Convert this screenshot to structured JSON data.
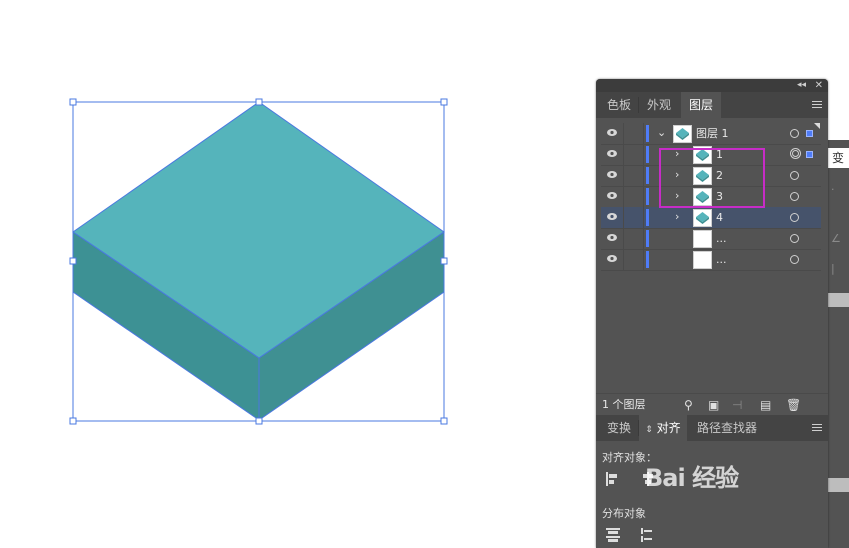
{
  "canvas": {
    "box": {
      "top_color": "#55b4bb",
      "left_color": "#3d9194",
      "right_color": "#3f9092",
      "selection_color": "#4a78e0"
    }
  },
  "panel": {
    "tabs": [
      {
        "label": "色板",
        "active": false
      },
      {
        "label": "外观",
        "active": false
      },
      {
        "label": "图层",
        "active": true
      }
    ],
    "layers": [
      {
        "label": "图层  1",
        "expanded": true,
        "indent": 0,
        "has_chevron": true,
        "thumb": "diamond",
        "selected": false,
        "target": "single",
        "sel_square": true
      },
      {
        "label": "1",
        "expanded": false,
        "indent": 1,
        "has_chevron": true,
        "thumb": "diamond",
        "selected": false,
        "target": "double",
        "sel_square": true
      },
      {
        "label": "2",
        "expanded": false,
        "indent": 1,
        "has_chevron": true,
        "thumb": "diamond",
        "selected": false,
        "target": "single",
        "sel_square": false
      },
      {
        "label": "3",
        "expanded": false,
        "indent": 1,
        "has_chevron": true,
        "thumb": "diamond",
        "selected": false,
        "target": "single",
        "sel_square": false
      },
      {
        "label": "4",
        "expanded": false,
        "indent": 1,
        "has_chevron": true,
        "thumb": "diamond",
        "selected": true,
        "target": "single",
        "sel_square": false
      },
      {
        "label": "...",
        "expanded": false,
        "indent": 1,
        "has_chevron": false,
        "thumb": "blank",
        "selected": false,
        "target": "single",
        "sel_square": false
      },
      {
        "label": "...",
        "expanded": false,
        "indent": 1,
        "has_chevron": false,
        "thumb": "blank",
        "selected": false,
        "target": "single",
        "sel_square": false
      }
    ],
    "footer_text": "1 个图层",
    "tabs2": [
      {
        "label": "变换",
        "active": false
      },
      {
        "label": "对齐",
        "active": true
      },
      {
        "label": "路径查找器",
        "active": false
      }
    ],
    "align_objects_label": "对齐对象：",
    "distribute_objects_label": "分布对象",
    "accent_color": "#4f7cf7",
    "highlight_color": "#c72cc7"
  },
  "side": {
    "tab_label": "变"
  },
  "watermark": "Bai 经验"
}
